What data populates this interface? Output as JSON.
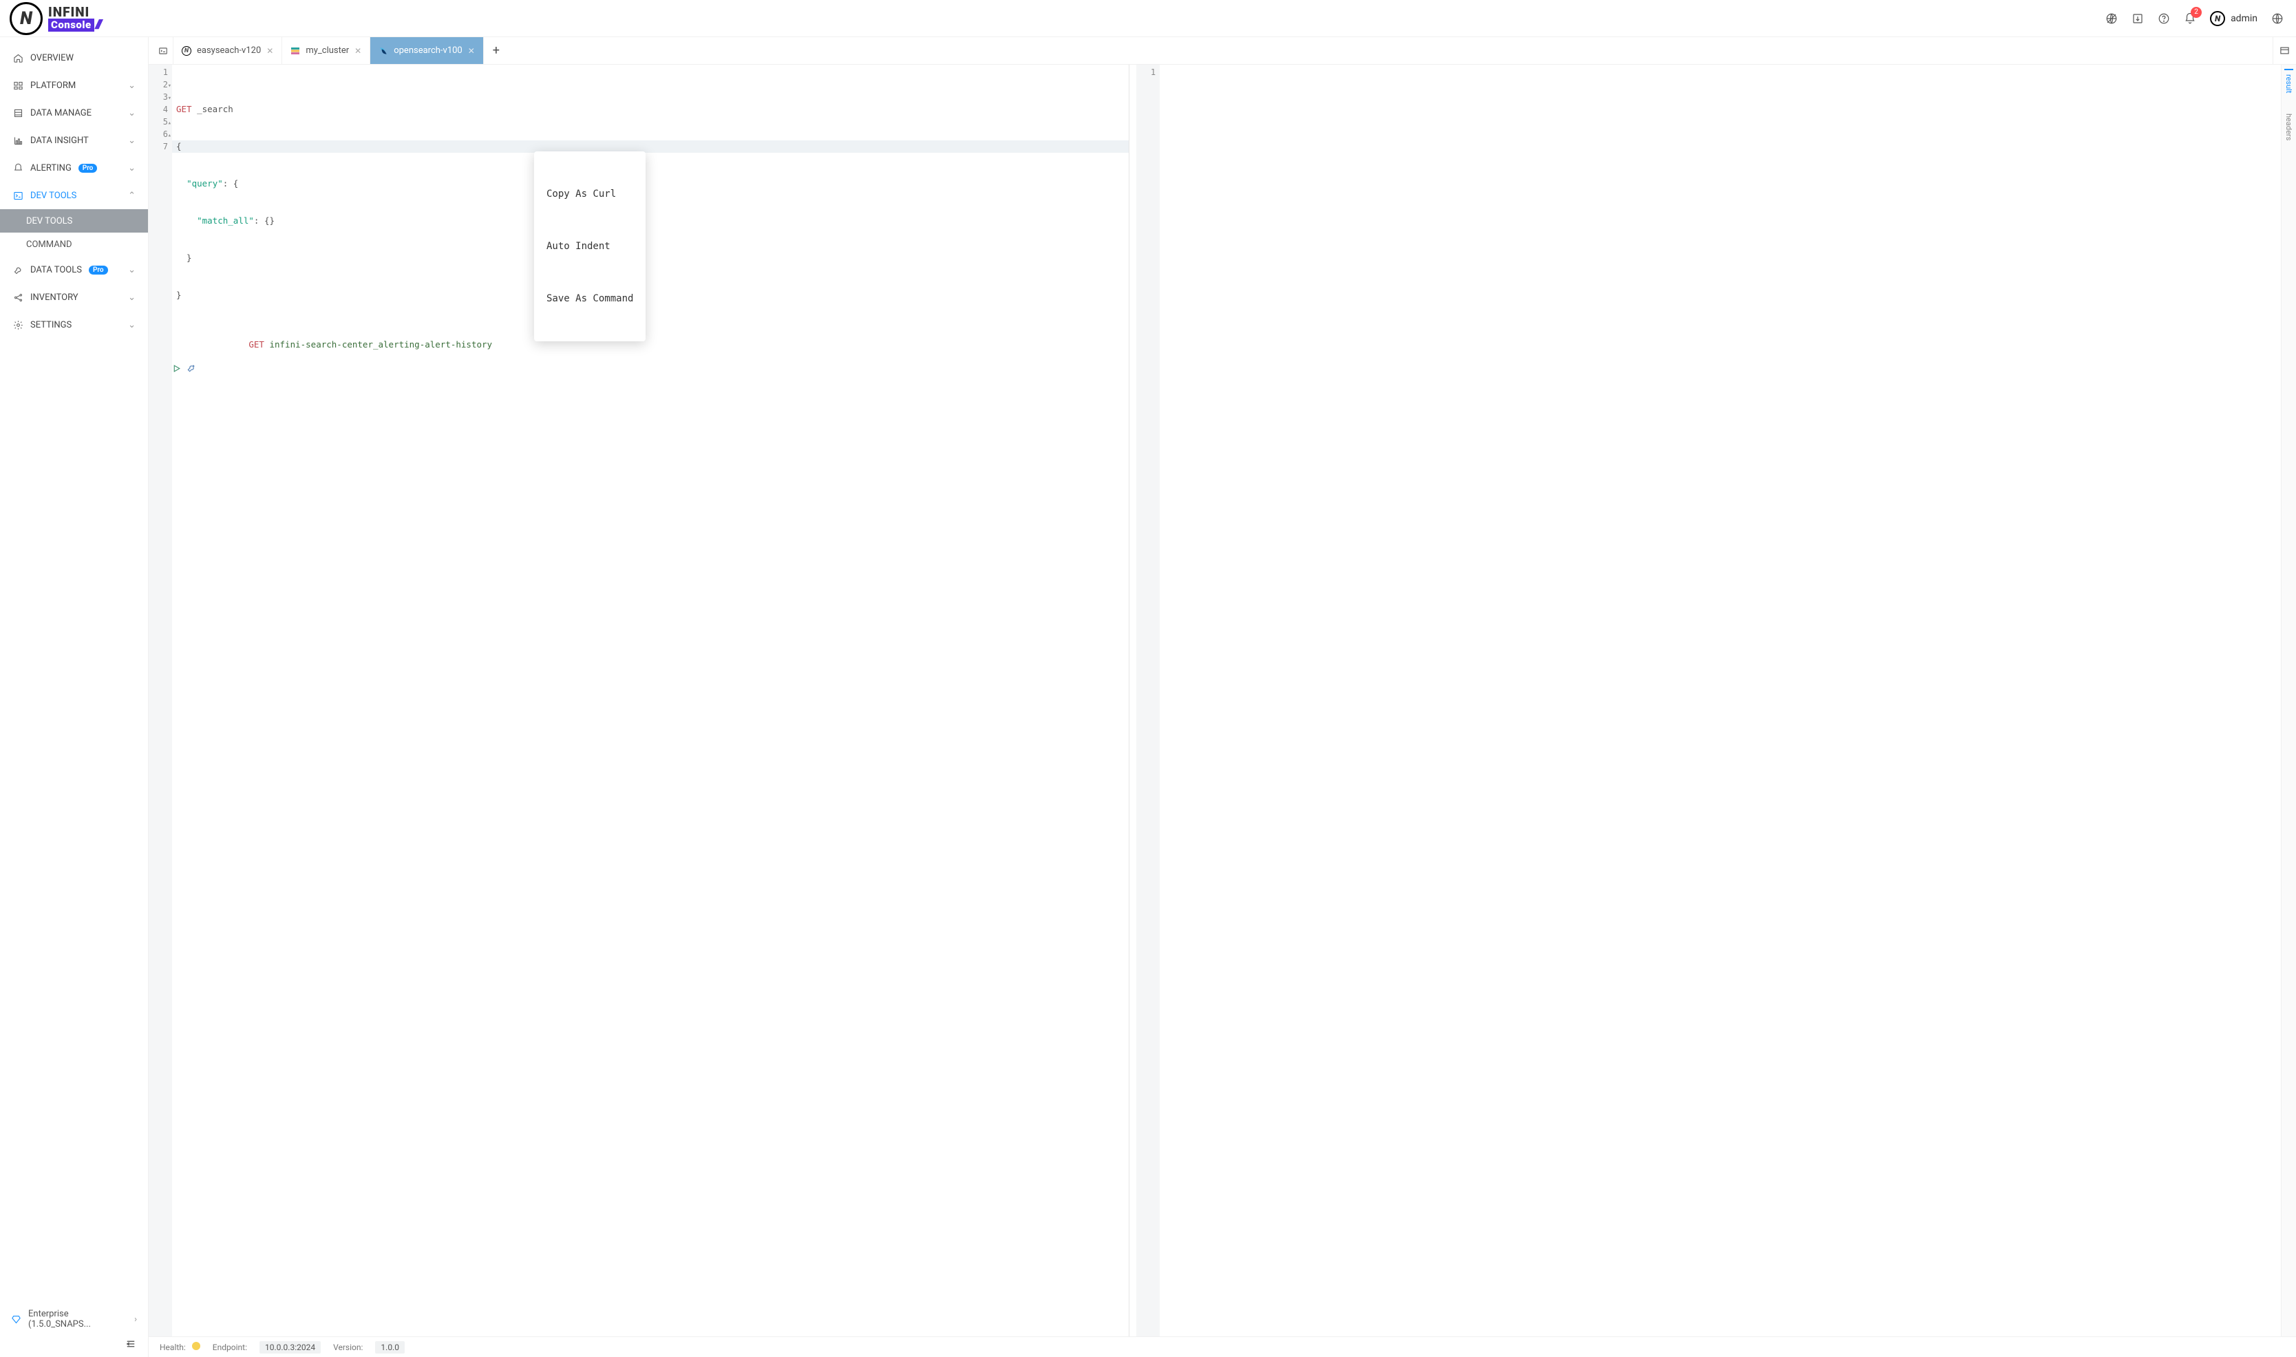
{
  "brand": {
    "top": "INFINI",
    "bottom": "Console"
  },
  "header": {
    "notif_count": "2",
    "username": "admin"
  },
  "sidebar": {
    "items": [
      {
        "label": "OVERVIEW"
      },
      {
        "label": "PLATFORM"
      },
      {
        "label": "DATA MANAGE"
      },
      {
        "label": "DATA INSIGHT"
      },
      {
        "label": "ALERTING",
        "badge": "Pro"
      },
      {
        "label": "DEV TOOLS"
      },
      {
        "label": "DATA TOOLS",
        "badge": "Pro"
      },
      {
        "label": "INVENTORY"
      },
      {
        "label": "SETTINGS"
      }
    ],
    "devtools_sub": [
      {
        "label": "DEV TOOLS"
      },
      {
        "label": "COMMAND"
      }
    ],
    "enterprise": "Enterprise (1.5.0_SNAPS..."
  },
  "tabs": [
    {
      "label": "easyseach-v120"
    },
    {
      "label": "my_cluster"
    },
    {
      "label": "opensearch-v100"
    }
  ],
  "editor": {
    "lines": {
      "l1_kw": "GET",
      "l1_rest": " _search",
      "l2": "{",
      "l3_q": "\"query\"",
      "l3_rest": ": {",
      "l4_m": "\"match_all\"",
      "l4_rest": ": {}",
      "l5": "  }",
      "l6": "}",
      "l7_kw": "GET",
      "l7_idx": " infini-search-center_alerting-alert-history"
    },
    "line_numbers": [
      "1",
      "2",
      "3",
      "4",
      "5",
      "6",
      "7"
    ]
  },
  "result": {
    "line1": "1"
  },
  "side_tabs": {
    "result": "result",
    "headers": "headers"
  },
  "context_menu": {
    "copy_curl": "Copy As Curl",
    "auto_indent": "Auto Indent",
    "save_cmd": "Save As Command"
  },
  "status": {
    "health_label": "Health:",
    "endpoint_label": "Endpoint:",
    "endpoint_value": "10.0.0.3:2024",
    "version_label": "Version:",
    "version_value": "1.0.0"
  }
}
